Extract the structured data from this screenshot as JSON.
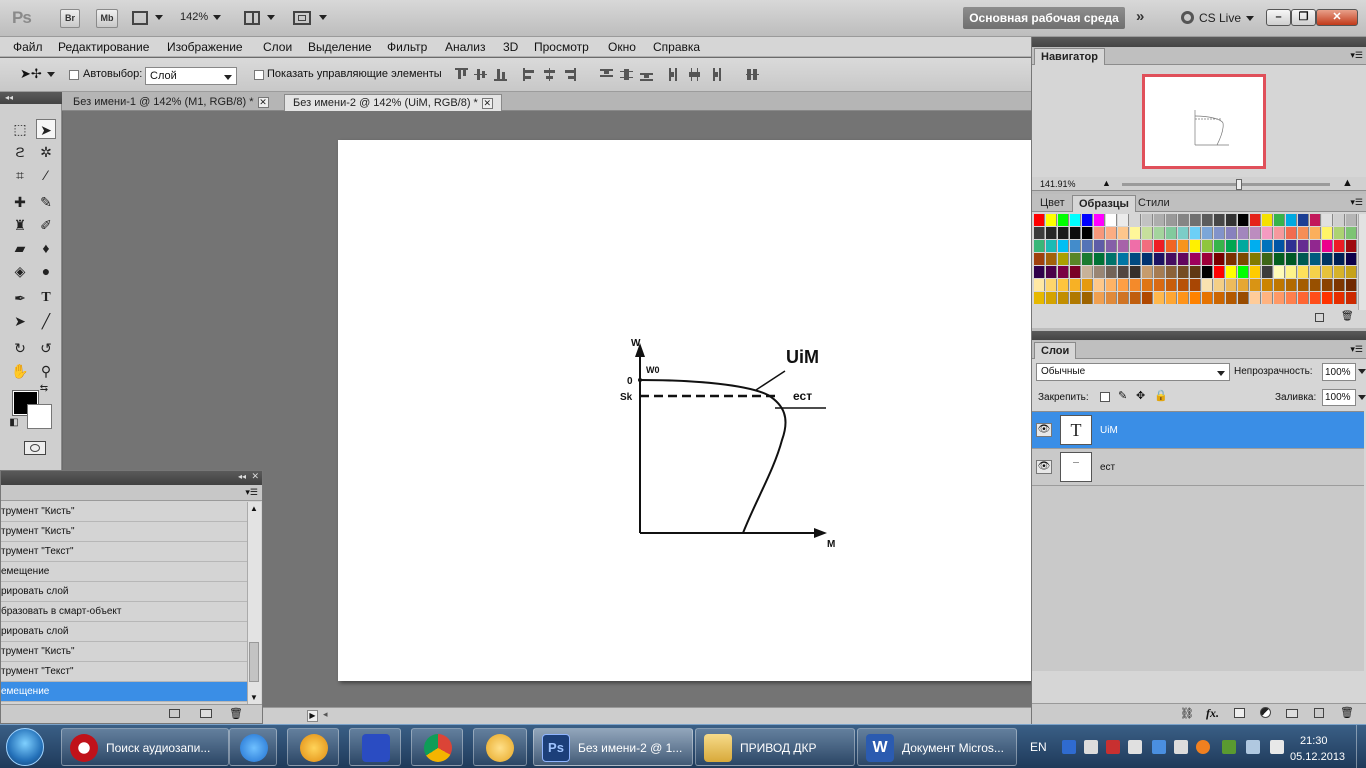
{
  "appbar": {
    "logo": "Ps",
    "bridge": "Br",
    "minibridge": "Mb",
    "zoom": "142%",
    "workspace": "Основная рабочая среда",
    "cslive": "CS Live"
  },
  "menu": [
    "Файл",
    "Редактирование",
    "Изображение",
    "Слои",
    "Выделение",
    "Фильтр",
    "Анализ",
    "3D",
    "Просмотр",
    "Окно",
    "Справка"
  ],
  "options": {
    "autoselect_label": "Автовыбор:",
    "autoselect_value": "Слой",
    "show_controls_label": "Показать управляющие элементы"
  },
  "tabs": [
    {
      "label": "Без имени-1 @ 142% (M1, RGB/8) *"
    },
    {
      "label": "Без имени-2 @ 142% (UiM, RGB/8) *"
    }
  ],
  "drawing": {
    "w_label": "W",
    "w0_label": "W0",
    "zero_label": "0",
    "sk_label": "Sk",
    "uim_label": "UiM",
    "est_label": "ест",
    "m_label": "M"
  },
  "history": {
    "items": [
      "трумент \"Кисть\"",
      "трумент \"Кисть\"",
      "трумент \"Текст\"",
      "емещение",
      "рировать слой",
      "бразовать в смарт-объект",
      "рировать слой",
      "трумент \"Кисть\"",
      "трумент \"Текст\"",
      "емещение"
    ],
    "selected_index": 9
  },
  "navigator": {
    "title": "Навигатор",
    "zoom": "141.91%"
  },
  "swatches": {
    "tabs": [
      "Цвет",
      "Образцы",
      "Стили"
    ],
    "active_tab": "Образцы"
  },
  "layers": {
    "tab": "Слои",
    "blend_mode": "Обычные",
    "opacity_label": "Непрозрачность:",
    "opacity": "100%",
    "lock_label": "Закрепить:",
    "fill_label": "Заливка:",
    "fill": "100%",
    "items": [
      {
        "name": "UiM",
        "thumb": "T",
        "selected": true
      },
      {
        "name": "ест",
        "thumb": "",
        "selected": false
      }
    ]
  },
  "taskbar": {
    "buttons": [
      {
        "label": "Поиск аудиозапи...",
        "icon": "opera-icon",
        "color": "#c0121a"
      },
      {
        "label": "",
        "icon": "lightning-app-icon",
        "color": "#1f7de0"
      },
      {
        "label": "",
        "icon": "aimp-icon",
        "color": "#e08a10"
      },
      {
        "label": "",
        "icon": "save-floppy-icon",
        "color": "#2a4cc2"
      },
      {
        "label": "",
        "icon": "chrome-icon",
        "color": "#3aa84a"
      },
      {
        "label": "",
        "icon": "fl-studio-icon",
        "color": "#e6a623"
      },
      {
        "label": "Без имени-2 @ 1...",
        "icon": "photoshop-icon",
        "color": "#1c3f7a"
      },
      {
        "label": "ПРИВОД ДКР",
        "icon": "folder-icon",
        "color": "#e8c35a"
      },
      {
        "label": "Документ Micros...",
        "icon": "word-icon",
        "color": "#2b5bb0"
      }
    ],
    "lang": "EN",
    "time": "21:30",
    "date": "05.12.2013"
  }
}
